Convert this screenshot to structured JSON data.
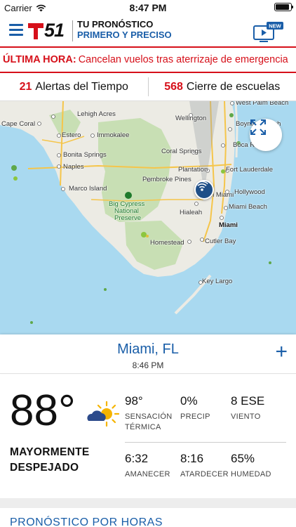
{
  "status_bar": {
    "carrier": "Carrier",
    "time": "8:47 PM"
  },
  "header": {
    "logo_text": "51",
    "tagline_line1": "TU PRONÓSTICO",
    "tagline_line2": "PRIMERO Y PRECISO",
    "tv_badge": "NEW",
    "brand_red": "#d6101a",
    "brand_blue": "#1a5ea8"
  },
  "breaking": {
    "label": "ÚLTIMA HORA:",
    "text": "Cancelan vuelos tras aterrizaje de emergencia"
  },
  "alerts": [
    {
      "count": "21",
      "label": "Alertas del Tiempo"
    },
    {
      "count": "568",
      "label": "Cierre de escuelas"
    }
  ],
  "map": {
    "labels": {
      "west_palm_beach": "West Palm Beach",
      "lehigh_acres": "Lehigh Acres",
      "wellington": "Wellington",
      "cape_coral": "Cape Coral",
      "boynton_beach": "Boynton Beach",
      "estero": "Estero",
      "immokalee": "Immokalee",
      "boca_raton": "Boca Raton",
      "coral_springs": "Coral Springs",
      "bonita_springs": "Bonita Springs",
      "naples": "Naples",
      "plantation": "Plantation",
      "fort_lauderdale": "Fort Lauderdale",
      "pembroke_pines": "Pembroke Pines",
      "hollywood": "Hollywood",
      "marco_island": "Marco Island",
      "north_miami": "North Miami",
      "big_cypress": "Big Cypress",
      "national": "National",
      "preserve": "Preserve",
      "hialeah": "Hialeah",
      "miami_beach": "Miami Beach",
      "miami": "Miami",
      "homestead": "Homestead",
      "cutler_bay": "Cutler Bay",
      "key_largo": "Key Largo"
    }
  },
  "location": {
    "name": "Miami, FL",
    "time": "8:46 PM"
  },
  "current": {
    "temp": "88°",
    "condition_line1": "MAYORMENTE",
    "condition_line2": "DESPEJADO",
    "icon": "partly-cloudy-icon",
    "stats": [
      {
        "value": "98°",
        "label_line1": "SENSACIÓN",
        "label_line2": "TÉRMICA"
      },
      {
        "value": "0%",
        "label_line1": "PRECIP",
        "label_line2": ""
      },
      {
        "value": "8 ESE",
        "label_line1": "VIENTO",
        "label_line2": ""
      },
      {
        "value": "6:32",
        "label_line1": "AMANECER",
        "label_line2": ""
      },
      {
        "value": "8:16",
        "label_line1": "ATARDECER",
        "label_line2": ""
      },
      {
        "value": "65%",
        "label_line1": "HUMEDAD",
        "label_line2": ""
      }
    ]
  },
  "hourly": {
    "title": "PRONÓSTICO POR HORAS"
  }
}
